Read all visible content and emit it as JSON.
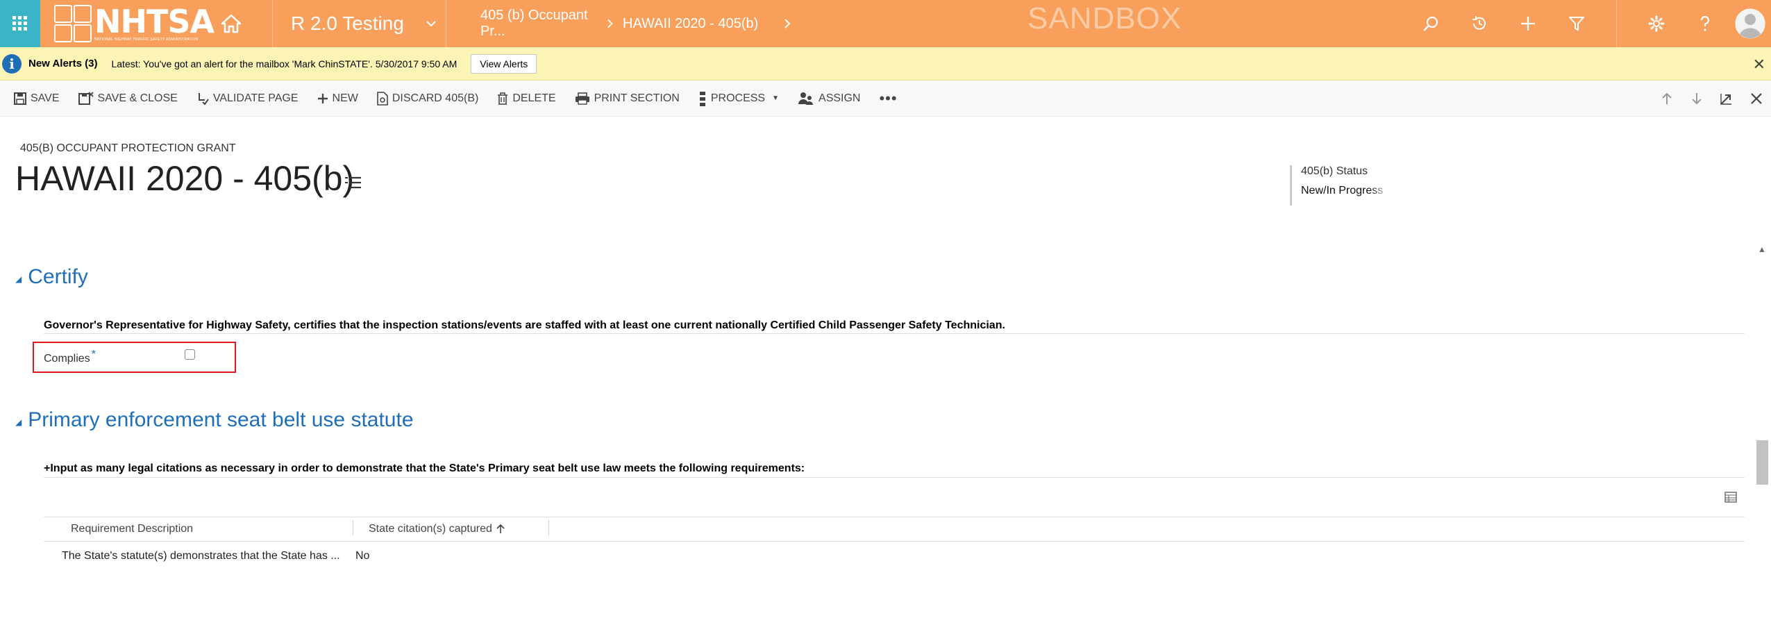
{
  "nav": {
    "logo_text": "NHTSA",
    "logo_subtext": "NATIONAL HIGHWAY TRAFFIC SAFETY ADMINISTRATION",
    "app_name": "R 2.0 Testing",
    "breadcrumbs": [
      {
        "label": "405 (b) Occupant Pr..."
      },
      {
        "label": "HAWAII 2020 - 405(b)"
      }
    ],
    "sandbox_label": "SANDBOX",
    "icons": [
      "search-icon",
      "history-icon",
      "plus-icon",
      "filter-icon",
      "gear-icon",
      "help-icon",
      "user-avatar-icon"
    ],
    "colors": {
      "bar": "#f8a05b",
      "waffle": "#3cb4c8"
    }
  },
  "alert": {
    "title": "New Alerts (3)",
    "message": "Latest: You've got an alert for the mailbox 'Mark ChinSTATE'. 5/30/2017 9:50 AM",
    "button": "View Alerts"
  },
  "commands": {
    "save": "SAVE",
    "save_close": "SAVE & CLOSE",
    "validate": "VALIDATE PAGE",
    "new": "NEW",
    "discard": "DISCARD 405(B)",
    "delete": "DELETE",
    "print": "PRINT SECTION",
    "process": "PROCESS",
    "assign": "ASSIGN",
    "more": "•••"
  },
  "header": {
    "entity_type": "405(B) OCCUPANT PROTECTION GRANT",
    "title": "HAWAII 2020 - 405(b)",
    "status_label": "405(b) Status",
    "status_value": "New/In Progress"
  },
  "certify": {
    "title": "Certify",
    "instruction": "Governor's Representative for Highway Safety, certifies that the inspection stations/events are staffed with at least one current nationally Certified Child Passenger Safety Technician.",
    "complies_label": "Complies",
    "required_mark": "*",
    "complies_checked": false
  },
  "primary": {
    "title": "Primary enforcement seat belt use statute",
    "instruction": "+Input as many legal citations as necessary in order to demonstrate that the State's Primary seat belt use law meets the following requirements:",
    "columns": [
      "Requirement Description",
      "State citation(s) captured"
    ],
    "rows": [
      {
        "description": "The State's statute(s) demonstrates that the State has ...",
        "captured": "No"
      }
    ]
  },
  "accent_color": "#1f6fb8"
}
